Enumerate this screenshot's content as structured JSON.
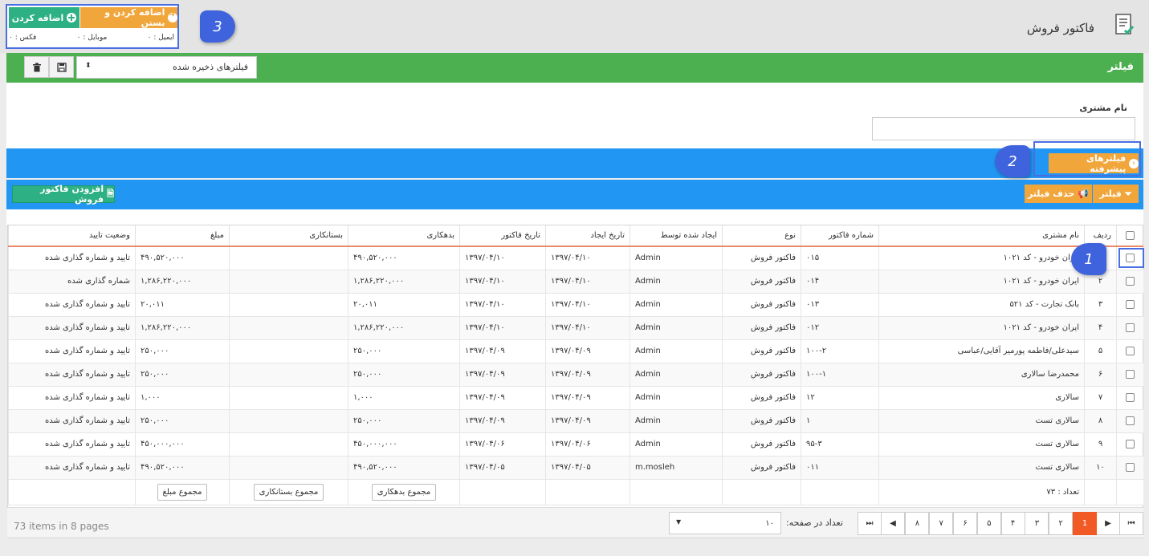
{
  "header": {
    "title": "فاکتور فروش",
    "add_label": "اضافه کردن",
    "add_close_label": "اضافه کردن و بستن",
    "email_label": "ایمیل :",
    "email_value": "۰",
    "mobile_label": "موبایل :",
    "mobile_value": "۰",
    "fax_label": "فکس :",
    "fax_value": "۰"
  },
  "annotations": [
    "1",
    "2",
    "3"
  ],
  "filter": {
    "title": "فیلتر",
    "saved_filters_placeholder": "فیلترهای ذخیره شده",
    "customer_name_label": "نام مشتری",
    "advanced_label": "فیلترهای پیشرفته",
    "apply_label": "فیلتر",
    "clear_label": "حذف فیلتر",
    "add_invoice_label": "افزودن فاکتور فروش"
  },
  "table": {
    "columns": [
      "ردیف",
      "نام مشتری",
      "شماره فاکتور",
      "نوع",
      "ایجاد شده توسط",
      "تاریخ ایجاد",
      "تاریخ فاکتور",
      "بدهکاری",
      "بستانکاری",
      "مبلغ",
      "وضعیت تایید"
    ],
    "rows": [
      {
        "idx": "",
        "customer": "ایران خودرو - کد ۱۰۲۱",
        "number": "۰۱۵",
        "type": "فاکتور فروش",
        "by": "Admin",
        "created": "۱۳۹۷/۰۴/۱۰",
        "date": "۱۳۹۷/۰۴/۱۰",
        "debit": "۴۹۰,۵۲۰,۰۰۰",
        "credit": "",
        "amount": "۴۹۰,۵۲۰,۰۰۰",
        "status": "تایید و شماره گذاری شده"
      },
      {
        "idx": "۲",
        "customer": "ایران خودرو - کد ۱۰۲۱",
        "number": "۰۱۴",
        "type": "فاکتور فروش",
        "by": "Admin",
        "created": "۱۳۹۷/۰۴/۱۰",
        "date": "۱۳۹۷/۰۴/۱۰",
        "debit": "۱,۲۸۶,۲۲۰,۰۰۰",
        "credit": "",
        "amount": "۱,۲۸۶,۲۲۰,۰۰۰",
        "status": "شماره گذاری شده"
      },
      {
        "idx": "۳",
        "customer": "بانک تجارت - کد ۵۲۱",
        "number": "۰۱۳",
        "type": "فاکتور فروش",
        "by": "Admin",
        "created": "۱۳۹۷/۰۴/۱۰",
        "date": "۱۳۹۷/۰۴/۱۰",
        "debit": "۲۰,۰۱۱",
        "credit": "",
        "amount": "۲۰,۰۱۱",
        "status": "تایید و شماره گذاری شده"
      },
      {
        "idx": "۴",
        "customer": "ایران خودرو - کد ۱۰۲۱",
        "number": "۰۱۲",
        "type": "فاکتور فروش",
        "by": "Admin",
        "created": "۱۳۹۷/۰۴/۱۰",
        "date": "۱۳۹۷/۰۴/۱۰",
        "debit": "۱,۲۸۶,۲۲۰,۰۰۰",
        "credit": "",
        "amount": "۱,۲۸۶,۲۲۰,۰۰۰",
        "status": "تایید و شماره گذاری شده"
      },
      {
        "idx": "۵",
        "customer": "سیدعلی/فاطمه پورمیر آقایی/عباسی",
        "number": "۱۰۰-۲",
        "type": "فاکتور فروش",
        "by": "Admin",
        "created": "۱۳۹۷/۰۴/۰۹",
        "date": "۱۳۹۷/۰۴/۰۹",
        "debit": "۲۵۰,۰۰۰",
        "credit": "",
        "amount": "۲۵۰,۰۰۰",
        "status": "تایید و شماره گذاری شده"
      },
      {
        "idx": "۶",
        "customer": "محمدرضا سالاری",
        "number": "۱۰۰-۱",
        "type": "فاکتور فروش",
        "by": "Admin",
        "created": "۱۳۹۷/۰۴/۰۹",
        "date": "۱۳۹۷/۰۴/۰۹",
        "debit": "۲۵۰,۰۰۰",
        "credit": "",
        "amount": "۲۵۰,۰۰۰",
        "status": "تایید و شماره گذاری شده"
      },
      {
        "idx": "۷",
        "customer": "سالاری",
        "number": "۱۲",
        "type": "فاکتور فروش",
        "by": "Admin",
        "created": "۱۳۹۷/۰۴/۰۹",
        "date": "۱۳۹۷/۰۴/۰۹",
        "debit": "۱,۰۰۰",
        "credit": "",
        "amount": "۱,۰۰۰",
        "status": "تایید و شماره گذاری شده"
      },
      {
        "idx": "۸",
        "customer": "سالاری تست",
        "number": "۱",
        "type": "فاکتور فروش",
        "by": "Admin",
        "created": "۱۳۹۷/۰۴/۰۹",
        "date": "۱۳۹۷/۰۴/۰۹",
        "debit": "۲۵۰,۰۰۰",
        "credit": "",
        "amount": "۲۵۰,۰۰۰",
        "status": "تایید و شماره گذاری شده"
      },
      {
        "idx": "۹",
        "customer": "سالاری تست",
        "number": "۹۵-۳",
        "type": "فاکتور فروش",
        "by": "Admin",
        "created": "۱۳۹۷/۰۴/۰۶",
        "date": "۱۳۹۷/۰۴/۰۶",
        "debit": "۴۵۰,۰۰۰,۰۰۰",
        "credit": "",
        "amount": "۴۵۰,۰۰۰,۰۰۰",
        "status": "تایید و شماره گذاری شده"
      },
      {
        "idx": "۱۰",
        "customer": "سالاری تست",
        "number": "۰۱۱",
        "type": "فاکتور فروش",
        "by": "m.mosleh",
        "created": "۱۳۹۷/۰۴/۰۵",
        "date": "۱۳۹۷/۰۴/۰۵",
        "debit": "۴۹۰,۵۲۰,۰۰۰",
        "credit": "",
        "amount": "۴۹۰,۵۲۰,۰۰۰",
        "status": "تایید و شماره گذاری شده"
      }
    ],
    "footer": {
      "count_label": "تعداد : ۷۳",
      "sum_debit": "مجموع بدهکاری",
      "sum_credit": "مجموع بستانکاری",
      "sum_amount": "مجموع مبلغ"
    }
  },
  "pager": {
    "pages": [
      "1",
      "۲",
      "۳",
      "۴",
      "۵",
      "۶",
      "۷",
      "۸"
    ],
    "per_page_label": "تعداد در صفحه:",
    "per_page_value": "۱۰",
    "items_info": "73 items in 8 pages"
  },
  "colors": {
    "green": "#4caf50",
    "blue": "#2196f3",
    "orange": "#f1a63b",
    "teal": "#2db083",
    "annotation": "#3f63dc",
    "active_page": "#f15a24"
  }
}
